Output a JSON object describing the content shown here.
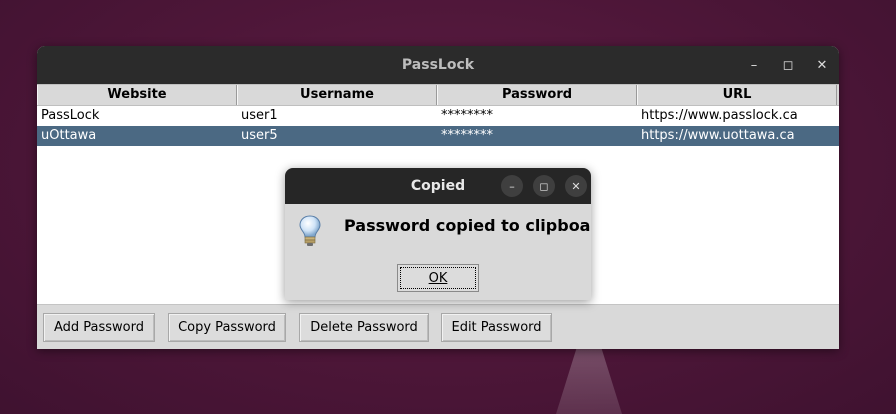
{
  "window": {
    "title": "PassLock",
    "controls": [
      "minimize-icon",
      "maximize-icon",
      "close-icon"
    ]
  },
  "table": {
    "columns": [
      "Website",
      "Username",
      "Password",
      "URL"
    ],
    "rows": [
      {
        "website": "PassLock",
        "username": "user1",
        "password": "********",
        "url": "https://www.passlock.ca",
        "selected": false
      },
      {
        "website": "uOttawa",
        "username": "user5",
        "password": "********",
        "url": "https://www.uottawa.ca",
        "selected": true
      }
    ]
  },
  "buttons": {
    "add": "Add Password",
    "copy": "Copy Password",
    "delete": "Delete Password",
    "edit": "Edit Password"
  },
  "dialog": {
    "title": "Copied",
    "message": "Password copied to clipboard!",
    "ok": "OK",
    "icon": "lightbulb-icon"
  },
  "colors": {
    "selection": "#4b6983",
    "titlebar": "#2b2b2b",
    "desktop": "#4d1638"
  }
}
